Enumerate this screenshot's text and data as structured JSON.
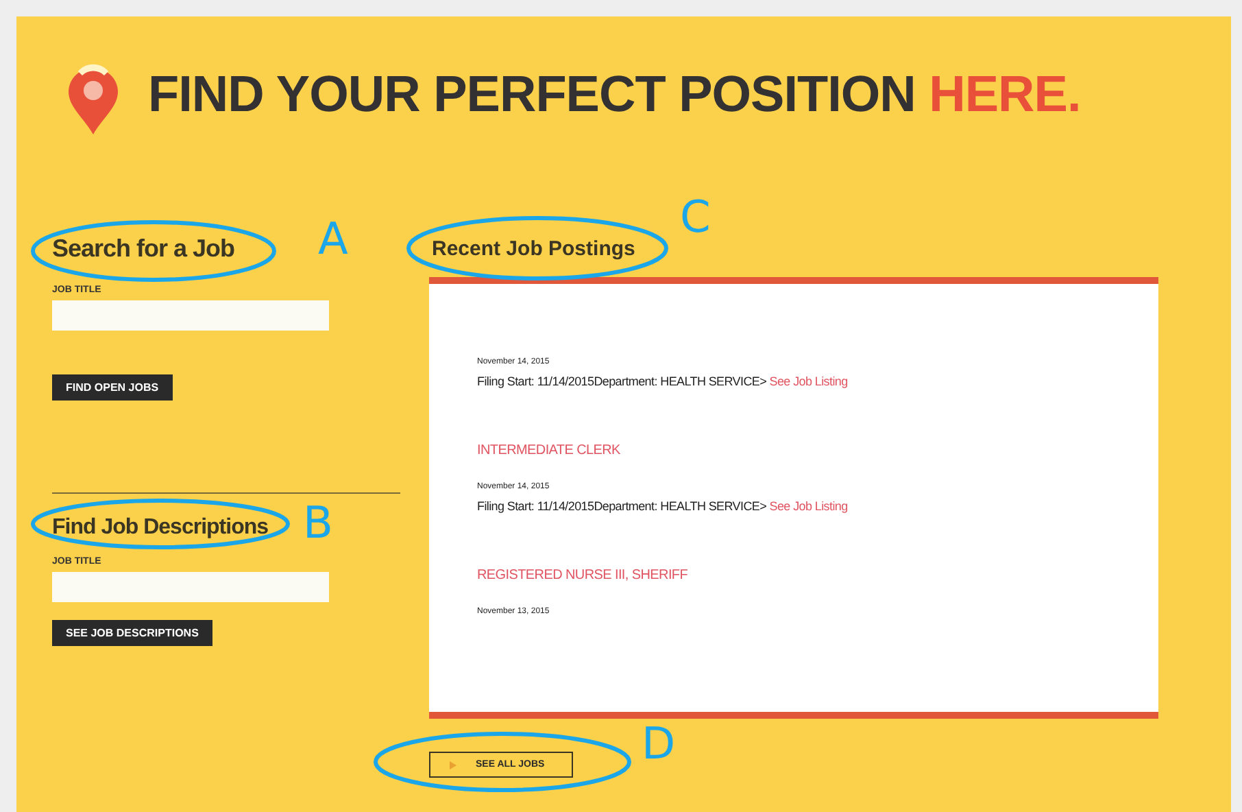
{
  "header": {
    "title": "FIND YOUR PERFECT POSITION",
    "highlight": "HERE."
  },
  "search_job": {
    "heading": "Search for a Job",
    "field_label": "JOB TITLE",
    "button": "FIND OPEN JOBS"
  },
  "find_descriptions": {
    "heading": "Find Job Descriptions",
    "field_label": "JOB TITLE",
    "button": "SEE JOB DESCRIPTIONS"
  },
  "recent_postings": {
    "heading": "Recent Job Postings",
    "postings": [
      {
        "date": "November 14, 2015",
        "details": "Filing Start: 11/14/2015Department: HEALTH SERVICE>",
        "link": "See Job Listing"
      },
      {
        "title": "INTERMEDIATE CLERK",
        "date": "November 14, 2015",
        "details": "Filing Start: 11/14/2015Department: HEALTH SERVICE>",
        "link": "See Job Listing"
      },
      {
        "title": "REGISTERED NURSE III, SHERIFF",
        "date": "November 13, 2015"
      }
    ],
    "button": "SEE ALL JOBS"
  },
  "annotations": [
    {
      "label": "A"
    },
    {
      "label": "B"
    },
    {
      "label": "C"
    },
    {
      "label": "D"
    }
  ]
}
